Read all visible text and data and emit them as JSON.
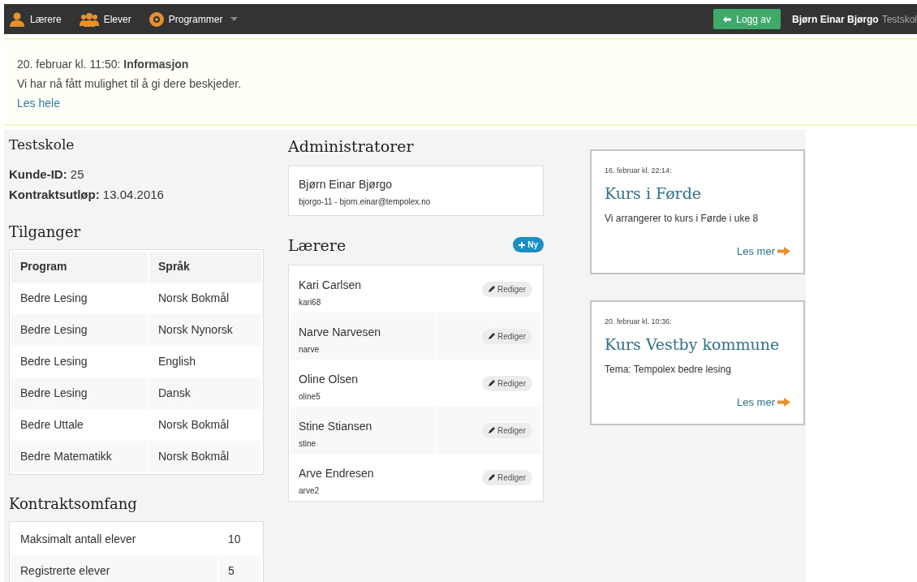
{
  "nav": {
    "items": [
      {
        "label": "Lærere",
        "dropdown": false
      },
      {
        "label": "Elever",
        "dropdown": false
      },
      {
        "label": "Programmer",
        "dropdown": true
      }
    ],
    "logout": "Logg av",
    "user": "Bjørn Einar Bjørgo",
    "school": "Testskol"
  },
  "notice": {
    "date": "20. februar kl. 11:50:",
    "title": "Informasjon",
    "text": "Vi har nå fått mulighet til å gi dere beskjeder.",
    "link": "Les hele"
  },
  "school": {
    "name": "Testskole",
    "fields": [
      {
        "label": "Kunde-ID:",
        "value": "25"
      },
      {
        "label": "Kontraktsutløp:",
        "value": "13.04.2016"
      }
    ]
  },
  "access": {
    "title": "Tilganger",
    "columns": [
      "Program",
      "Språk"
    ],
    "rows": [
      [
        "Bedre Lesing",
        "Norsk Bokmål"
      ],
      [
        "Bedre Lesing",
        "Norsk Nynorsk"
      ],
      [
        "Bedre Lesing",
        "English"
      ],
      [
        "Bedre Lesing",
        "Dansk"
      ],
      [
        "Bedre Uttale",
        "Norsk Bokmål"
      ],
      [
        "Bedre Matematikk",
        "Norsk Bokmål"
      ]
    ]
  },
  "scope": {
    "title": "Kontraktsomfang",
    "rows": [
      [
        "Maksimalt antall elever",
        "10"
      ],
      [
        "Registrerte elever",
        "5"
      ]
    ]
  },
  "admins": {
    "title": "Administratorer",
    "items": [
      {
        "name": "Bjørn Einar Bjørgo",
        "detail": "bjorgo-11 - bjorn.einar@tempolex.no"
      }
    ]
  },
  "teachers": {
    "title": "Lærere",
    "new_button": "Ny",
    "items": [
      {
        "name": "Kari Carlsen",
        "username": "kari68",
        "edit_label": "Rediger"
      },
      {
        "name": "Narve Narvesen",
        "username": "narve",
        "edit_label": "Rediger"
      },
      {
        "name": "Oline Olsen",
        "username": "oline5",
        "edit_label": "Rediger"
      },
      {
        "name": "Stine Stiansen",
        "username": "stine",
        "edit_label": "Rediger"
      },
      {
        "name": "Arve Endresen",
        "username": "arve2",
        "edit_label": "Rediger"
      }
    ]
  },
  "news": [
    {
      "date": "16. februar kl. 22:14:",
      "title": "Kurs i Førde",
      "text": "Vi arrangerer to kurs i Førde i uke 8",
      "link": "Les mer"
    },
    {
      "date": "20. februar kl. 10:36:",
      "title": "Kurs Vestby kommune",
      "text": "Tema: Tempolex bedre lesing",
      "link": "Les mer"
    }
  ]
}
